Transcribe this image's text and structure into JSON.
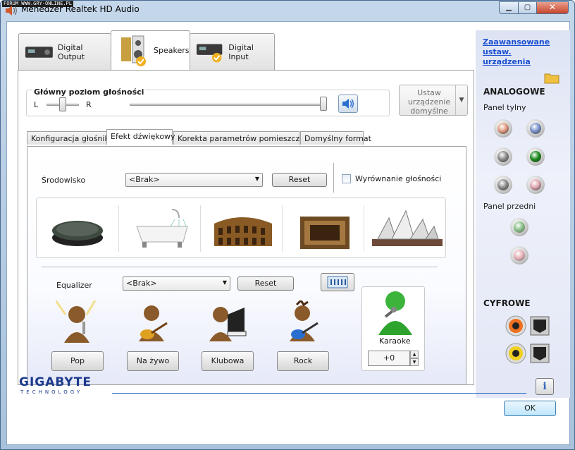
{
  "watermark": "FORUM WWW.GRY-ONLINE.PL",
  "window": {
    "title": "Menedżer Realtek HD Audio",
    "min": "▁",
    "max": "▢",
    "close": "✕"
  },
  "device_tabs": [
    {
      "label": "Digital Output"
    },
    {
      "label": "Speakers"
    },
    {
      "label": "Digital Input"
    }
  ],
  "volume": {
    "title": "Główny poziom głośności",
    "left_label": "L",
    "right_label": "R",
    "balance": 0.5,
    "level": 1.0
  },
  "default_device": {
    "label": "Ustaw urządzenie domyślne",
    "arrow": "▼"
  },
  "sub_tabs": [
    {
      "label": "Konfiguracja głośnika"
    },
    {
      "label": "Efekt dźwiękowy"
    },
    {
      "label": "Korekta parametrów pomieszczenia"
    },
    {
      "label": "Domyślny format"
    }
  ],
  "environment": {
    "label": "Środowisko",
    "value": "<Brak>",
    "reset": "Reset",
    "loudness_label": "Wyrównanie głośności",
    "loudness_checked": false,
    "presets": [
      "stone-icon",
      "bathtub-icon",
      "colosseum-icon",
      "arena-icon",
      "opera-house-icon"
    ]
  },
  "equalizer": {
    "label": "Equalizer",
    "value": "<Brak>",
    "reset": "Reset",
    "presets": [
      {
        "label": "Pop"
      },
      {
        "label": "Na żywo"
      },
      {
        "label": "Klubowa"
      },
      {
        "label": "Rock"
      }
    ]
  },
  "karaoke": {
    "label": "Karaoke",
    "value": "+0"
  },
  "right_panel": {
    "advanced_link": "Zaawansowane ustaw. urządzenia",
    "analog_heading": "ANALOGOWE",
    "rear_label": "Panel tylny",
    "front_label": "Panel przedni",
    "digital_heading": "CYFROWE",
    "rear_jacks": [
      "#e09a80",
      "#7a94cc",
      "#8c8c8c",
      "#1a8c1a",
      "#8c8c8c",
      "#e0a6b0"
    ],
    "front_jacks": [
      "#88c088",
      "#e8b0b8"
    ]
  },
  "footer": {
    "brand": "GIGABYTE",
    "brand_sub": "TECHNOLOGY",
    "info": "i",
    "ok": "OK"
  }
}
